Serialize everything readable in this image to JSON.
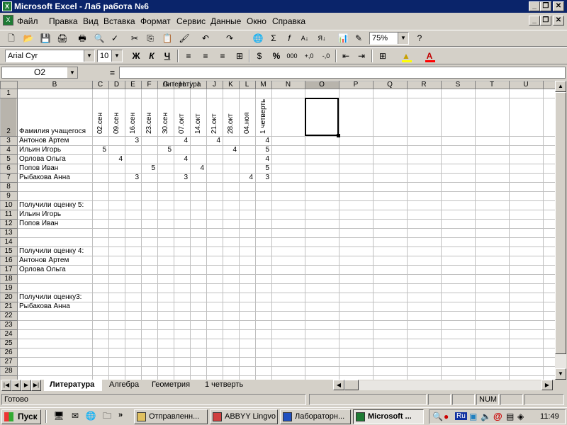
{
  "window": {
    "title": "Microsoft Excel - Лаб работа №6",
    "app_icon": "excel-icon",
    "controls": {
      "minimize": "_",
      "restore": "❐",
      "close": "✕"
    },
    "doc_controls": {
      "minimize": "_",
      "restore": "❐",
      "close": "✕"
    }
  },
  "menu": [
    {
      "label": "Файл"
    },
    {
      "label": "Правка"
    },
    {
      "label": "Вид"
    },
    {
      "label": "Вставка"
    },
    {
      "label": "Формат"
    },
    {
      "label": "Сервис"
    },
    {
      "label": "Данные"
    },
    {
      "label": "Окно"
    },
    {
      "label": "Справка"
    }
  ],
  "toolbar_std": {
    "zoom": "75%",
    "icons": [
      "new-icon",
      "open-icon",
      "save-icon",
      "permission-icon",
      "print-icon",
      "print-preview-icon",
      "spelling-icon",
      "cut-icon",
      "copy-icon",
      "paste-icon",
      "format-painter-icon",
      "undo-icon",
      "redo-icon",
      "hyperlink-icon",
      "autosum-icon",
      "function-icon",
      "sort-asc-icon",
      "sort-desc-icon",
      "chart-icon",
      "drawing-icon",
      "help-icon"
    ],
    "glyphs": [
      "🗋",
      "📂",
      "💾",
      "🖨",
      "🖶",
      "🔍",
      "✓",
      "✂",
      "⎘",
      "📋",
      "🖌",
      "↶",
      "↷",
      "🌐",
      "Σ",
      "f",
      "А↓",
      "Я↓",
      "📊",
      "✎",
      "?"
    ]
  },
  "toolbar_fmt": {
    "font": "Arial Cyr",
    "size": "10",
    "bold": "Ж",
    "italic": "К",
    "underline": "Ч",
    "percent": "%",
    "thousands": "000",
    "inc_decimal": "+,0",
    "dec_decimal": "-,0",
    "align_icons": [
      "align-left-icon",
      "align-center-icon",
      "align-right-icon",
      "merge-center-icon",
      "currency-icon"
    ]
  },
  "formula_bar": {
    "name_box": "O2",
    "equals": "=",
    "value": ""
  },
  "columns": [
    "B",
    "C",
    "D",
    "E",
    "F",
    "G",
    "H",
    "I",
    "J",
    "K",
    "L",
    "M",
    "N",
    "O",
    "P",
    "Q",
    "R",
    "S",
    "T",
    "U"
  ],
  "rows": [
    "1",
    "2",
    "3",
    "4",
    "5",
    "6",
    "7",
    "8",
    "9",
    "10",
    "11",
    "12",
    "13",
    "14",
    "15",
    "16",
    "17",
    "18",
    "19",
    "20",
    "21",
    "22",
    "23",
    "24",
    "25",
    "26",
    "27",
    "28"
  ],
  "sheet": {
    "title": "Литература",
    "student_header": "Фамилия учащегося",
    "dates": [
      "02.сен",
      "09.сен",
      "16.сен",
      "23.сен",
      "30.сен",
      "07.окт",
      "14.окт",
      "21.окт",
      "28.окт",
      "04.ноя",
      "1 четверть"
    ],
    "students": [
      {
        "name": "Антонов Артем",
        "grades": [
          "",
          "",
          "3",
          "",
          "",
          "4",
          "",
          "4",
          "",
          "",
          "4"
        ]
      },
      {
        "name": "Ильин Игорь",
        "grades": [
          "5",
          "",
          "",
          "",
          "5",
          "",
          "",
          "",
          "4",
          "",
          "5"
        ]
      },
      {
        "name": "Орлова Ольга",
        "grades": [
          "",
          "4",
          "",
          "",
          "",
          "4",
          "",
          "",
          "",
          "",
          "4"
        ]
      },
      {
        "name": "Попов Иван",
        "grades": [
          "",
          "",
          "",
          "5",
          "",
          "",
          "4",
          "",
          "",
          "",
          "5"
        ]
      },
      {
        "name": "Рыбакова Анна",
        "grades": [
          "",
          "",
          "3",
          "",
          "",
          "3",
          "",
          "",
          "",
          "4",
          "3"
        ]
      }
    ],
    "groups": [
      {
        "label": "Получили оценку 5:",
        "names": [
          "Ильин Игорь",
          "Попов Иван"
        ]
      },
      {
        "label": "Получили оценку 4:",
        "names": [
          "Антонов Артем",
          "Орлова Ольга"
        ]
      },
      {
        "label": "Получили оценку3:",
        "names": [
          "Рыбакова Анна"
        ]
      }
    ]
  },
  "tabs": [
    "Литература",
    "Алгебра",
    "Геометрия",
    "1 четверть"
  ],
  "active_tab": "Литература",
  "status": {
    "ready": "Готово",
    "num": "NUM"
  },
  "taskbar": {
    "start": "Пуск",
    "tasks": [
      {
        "label": "Отправленн..."
      },
      {
        "label": "ABBYY Lingvo"
      },
      {
        "label": "Лабораторн..."
      },
      {
        "label": "Microsoft ..."
      }
    ],
    "quick_more": "»",
    "lang": "Ru",
    "clock": "11:49"
  },
  "colors": {
    "title_bar": "#0a246a",
    "chrome": "#d4d0c8",
    "grid_line": "#c0c0c0",
    "selection": "#000000"
  }
}
